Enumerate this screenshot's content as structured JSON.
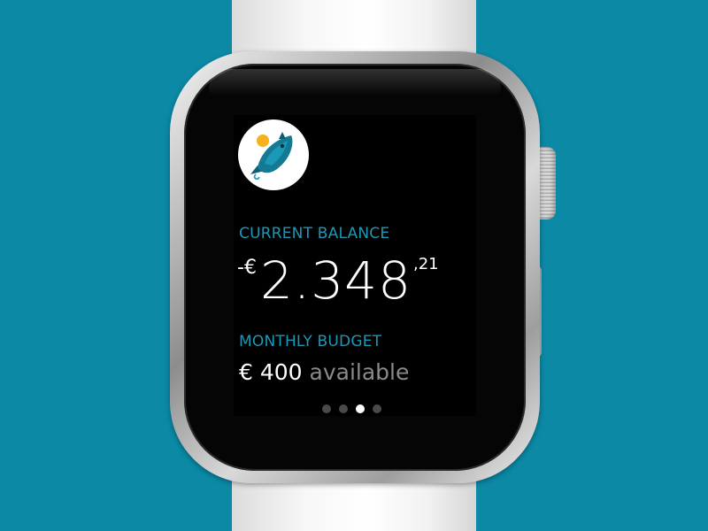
{
  "app": {
    "icon": "rocket-piggy-icon"
  },
  "balance": {
    "label": "CURRENT BALANCE",
    "prefix": "-€",
    "main": "2.348",
    "cents": ",21"
  },
  "budget": {
    "label": "MONTHLY BUDGET",
    "amount": "€ 400",
    "suffix": "available"
  },
  "pager": {
    "pages": 4,
    "current": 3
  },
  "colors": {
    "background": "#0b89a5",
    "accent": "#1b98b8",
    "icon_coin": "#f5b21a"
  }
}
